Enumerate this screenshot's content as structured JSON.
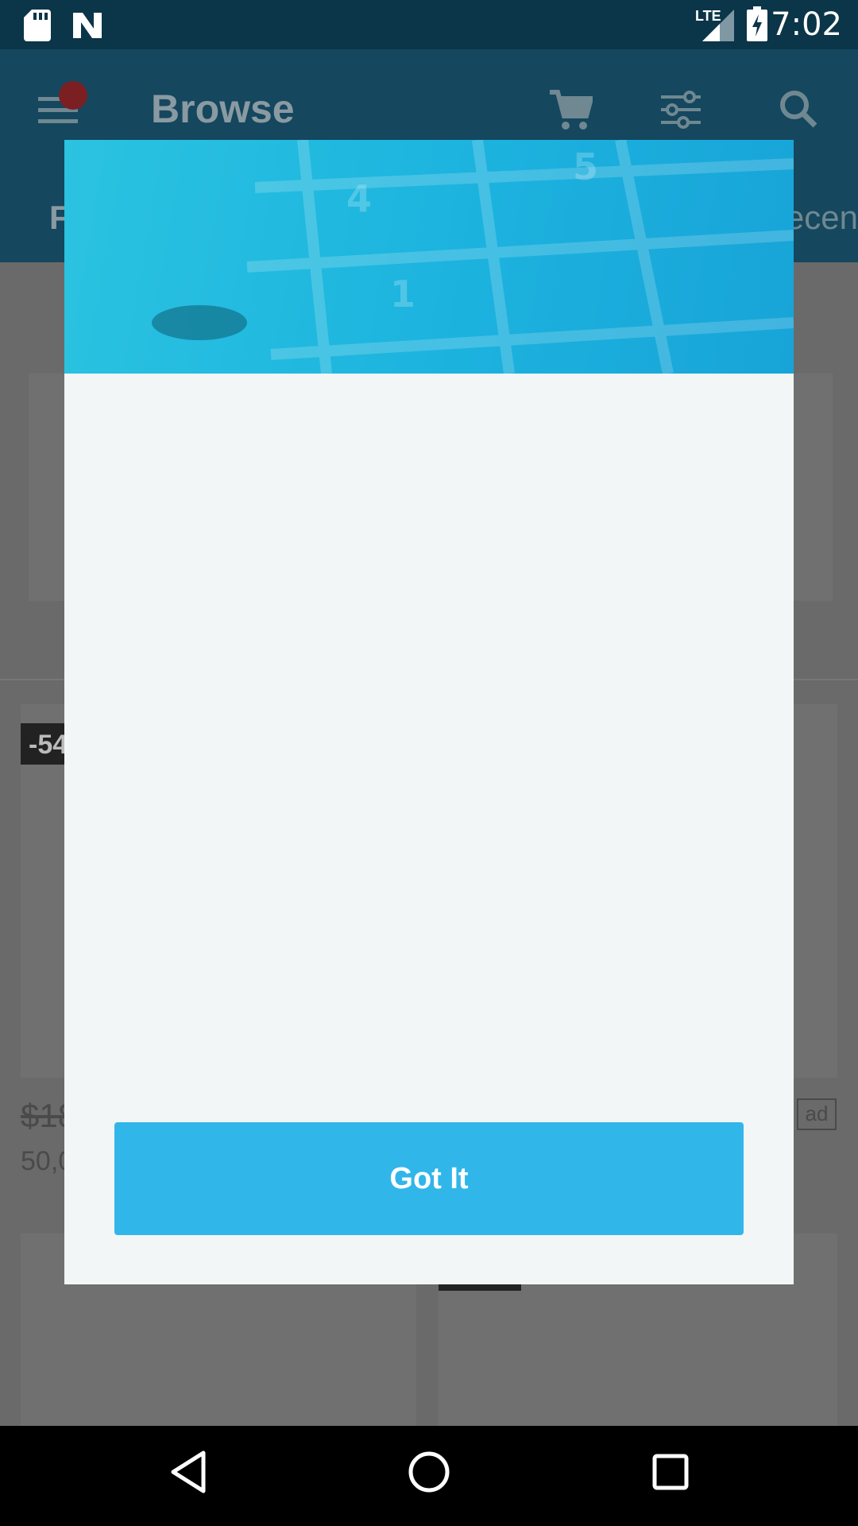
{
  "status_bar": {
    "time": "7:02",
    "network": "LTE",
    "icons": [
      "sd-card-icon",
      "n-logo-icon",
      "lte-signal-icon",
      "battery-charging-icon"
    ]
  },
  "app_bar": {
    "title": "Browse",
    "tab_left_partial": "F",
    "tab_right_partial": "ecen",
    "icons": [
      "menu-icon",
      "notification-dot-icon",
      "cart-icon",
      "filter-icon",
      "search-icon"
    ]
  },
  "background": {
    "discount_badge": "-54",
    "old_price": "$18",
    "sold_count": "50,0",
    "ad_label": "ad"
  },
  "dialog": {
    "button_label": "Got It"
  },
  "nav_bar": {
    "icons": [
      "back-icon",
      "home-icon",
      "recents-icon"
    ]
  },
  "colors": {
    "status_bar": "#0b3548",
    "app_bar": "#15475e",
    "dialog_bg": "#f2f6f7",
    "header_start": "#2bc3e0",
    "header_end": "#18a4d8",
    "button": "#31b6ea"
  }
}
